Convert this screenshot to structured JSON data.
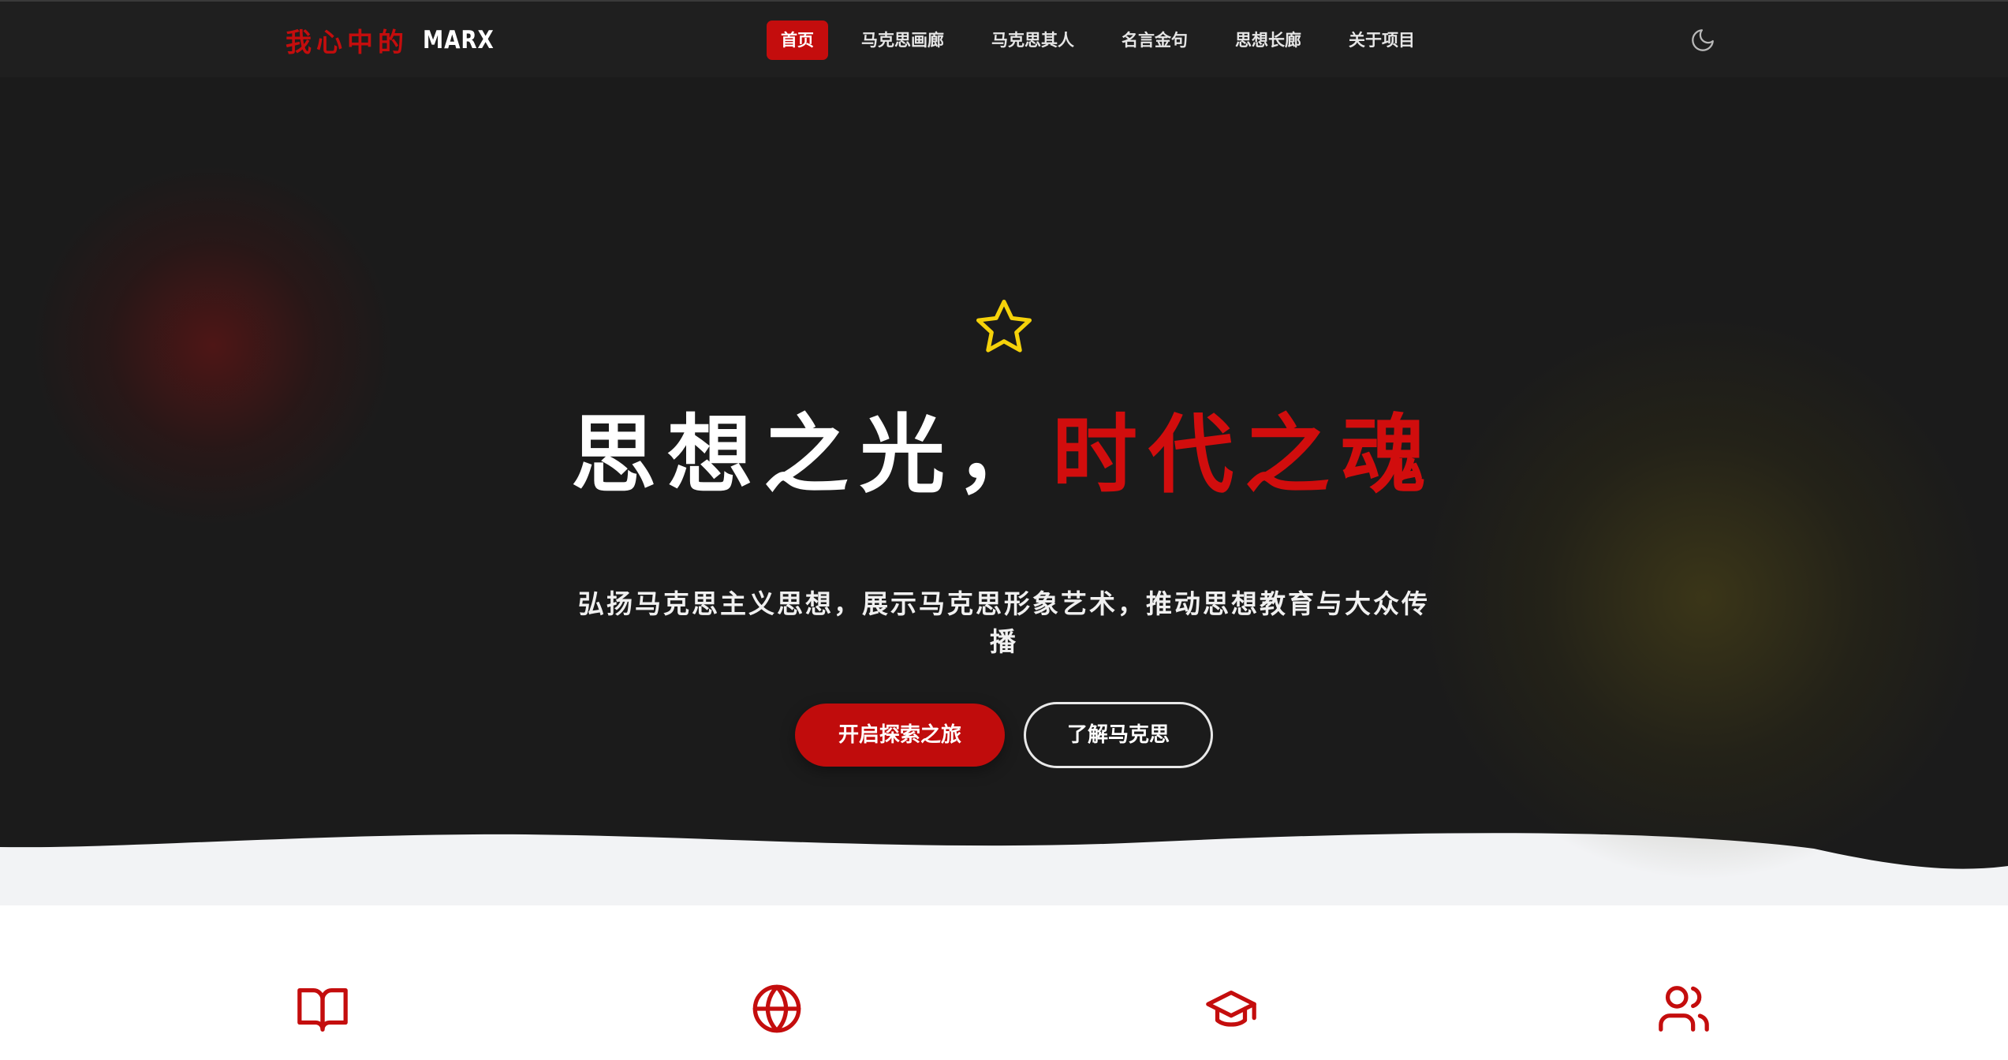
{
  "nav": {
    "logo_cn": "我心中的",
    "logo_en": "MARX",
    "items": [
      {
        "label": "首页",
        "active": true
      },
      {
        "label": "马克思画廊",
        "active": false
      },
      {
        "label": "马克思其人",
        "active": false
      },
      {
        "label": "名言金句",
        "active": false
      },
      {
        "label": "思想长廊",
        "active": false
      },
      {
        "label": "关于项目",
        "active": false
      }
    ],
    "theme_toggle_icon": "moon-icon"
  },
  "hero": {
    "icon": "star-icon",
    "title_white": "思想之光，",
    "title_red": "时代之魂",
    "subtitle": "弘扬马克思主义思想，展示马克思形象艺术，推动思想教育与大众传播",
    "primary_button": "开启探索之旅",
    "secondary_button": "了解马克思"
  },
  "features": {
    "icons": [
      "book-open-icon",
      "globe-icon",
      "graduation-cap-icon",
      "users-icon"
    ]
  },
  "colors": {
    "accent": "#c40d0d",
    "nav_bg": "#1f1f1f",
    "hero_bg": "#1b1b1b",
    "star": "#f5d20a",
    "section_bg": "#f2f3f5"
  }
}
